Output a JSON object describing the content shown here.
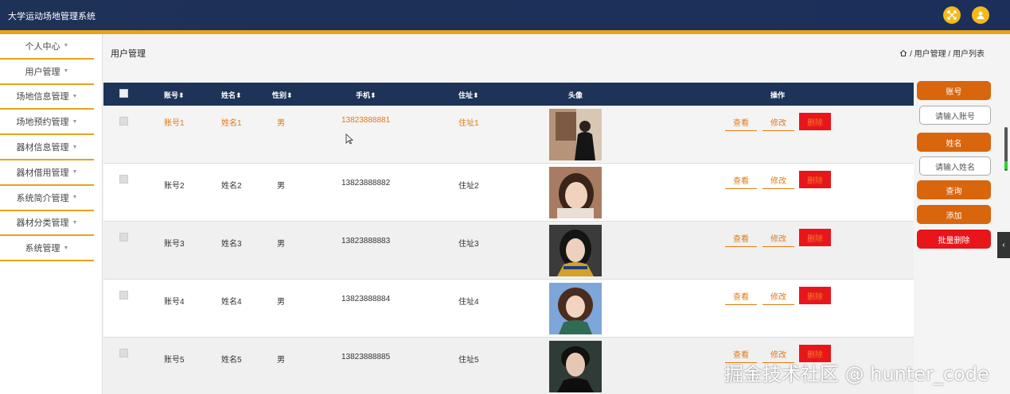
{
  "app": {
    "title": "大学运动场地管理系统"
  },
  "sidebar": {
    "items": [
      {
        "label": "个人中心"
      },
      {
        "label": "用户管理"
      },
      {
        "label": "场地信息管理"
      },
      {
        "label": "场地预约管理"
      },
      {
        "label": "器材信息管理"
      },
      {
        "label": "器材借用管理"
      },
      {
        "label": "系统简介管理"
      },
      {
        "label": "器材分类管理"
      },
      {
        "label": "系统管理"
      }
    ]
  },
  "page": {
    "heading": "用户管理",
    "breadcrumb": "/ 用户管理 / 用户列表"
  },
  "table": {
    "headers": {
      "account": "账号",
      "name": "姓名",
      "gender": "性别",
      "phone": "手机",
      "address": "住址",
      "avatar": "头像",
      "actions": "操作"
    },
    "sort_icon": "⬍",
    "rows": [
      {
        "account": "账号1",
        "name": "姓名1",
        "gender": "男",
        "phone": "13823888881",
        "address": "住址1",
        "view": "查看",
        "edit": "修改",
        "delete": "删除"
      },
      {
        "account": "账号2",
        "name": "姓名2",
        "gender": "男",
        "phone": "13823888882",
        "address": "住址2",
        "view": "查看",
        "edit": "修改",
        "delete": "删除"
      },
      {
        "account": "账号3",
        "name": "姓名3",
        "gender": "男",
        "phone": "13823888883",
        "address": "住址3",
        "view": "查看",
        "edit": "修改",
        "delete": "删除"
      },
      {
        "account": "账号4",
        "name": "姓名4",
        "gender": "男",
        "phone": "13823888884",
        "address": "住址4",
        "view": "查看",
        "edit": "修改",
        "delete": "删除"
      },
      {
        "account": "账号5",
        "name": "姓名5",
        "gender": "男",
        "phone": "13823888885",
        "address": "住址5",
        "view": "查看",
        "edit": "修改",
        "delete": "删除"
      }
    ]
  },
  "search_panel": {
    "account_label": "账号",
    "account_placeholder": "请输入账号",
    "name_label": "姓名",
    "name_placeholder": "请输入姓名",
    "query": "查询",
    "add": "添加",
    "batch_delete": "批量删除"
  },
  "watermark": "掘金技术社区 @ hunter_code",
  "colors": {
    "accent": "#e8a21a",
    "header": "#1d3358",
    "danger": "#e8151b",
    "orange": "#d9650d"
  }
}
